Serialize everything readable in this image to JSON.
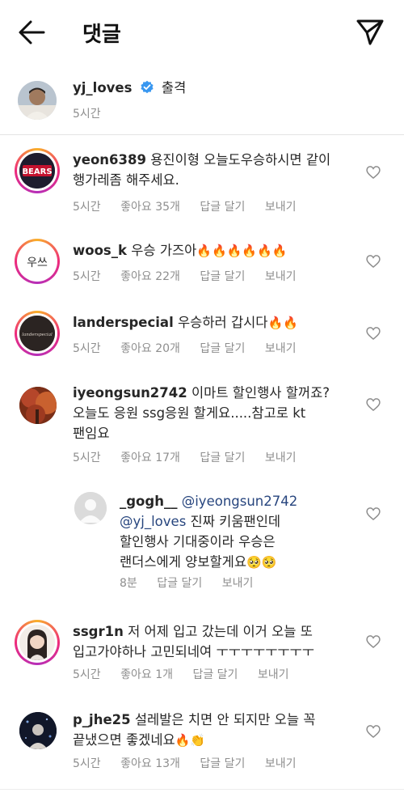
{
  "header": {
    "title": "댓글"
  },
  "caption": {
    "username": "yj_loves",
    "text": "출격",
    "time": "5시간"
  },
  "comments": [
    {
      "username": "yeon6389",
      "line1": "용진이형 오늘도우승하시면 같이",
      "line2": "행가레좀 해주세요.",
      "time": "5시간",
      "likes": "좋아요 35개",
      "reply": "답글 달기",
      "send": "보내기"
    },
    {
      "username": "woos_k",
      "line1": "우승 가즈아",
      "emoji": "🔥🔥🔥🔥🔥🔥",
      "time": "5시간",
      "likes": "좋아요 22개",
      "reply": "답글 달기",
      "send": "보내기"
    },
    {
      "username": "landerspecial",
      "line1": "우승하러 갑시다",
      "emoji": "🔥🔥",
      "time": "5시간",
      "likes": "좋아요 20개",
      "reply": "답글 달기",
      "send": "보내기"
    },
    {
      "username": "iyeongsun2742",
      "line1": "이마트 할인행사 할꺼죠?",
      "line2": "오늘도 응원 ssg응원 할게요.....참고로 kt",
      "line3": "팬임요",
      "time": "5시간",
      "likes": "좋아요 17개",
      "reply": "답글 달기",
      "send": "보내기"
    },
    {
      "username": "_gogh__",
      "mention1": "@iyeongsun2742",
      "mention2": "@yj_loves",
      "line2": "진짜 키움팬인데",
      "line3": "할인행사 기대중이라 우승은",
      "line4": "랜더스에게 양보할게요",
      "emoji": "🥺🥺",
      "time": "8분",
      "reply": "답글 달기",
      "send": "보내기"
    },
    {
      "username": "ssgr1n",
      "line1": "저 어제 입고 갔는데 이거 오늘 또",
      "line2": "입고가야하나 고민되네여 ㅜㅜㅜㅜㅜㅜㅜㅜ",
      "time": "5시간",
      "likes": "좋아요 1개",
      "reply": "답글 달기",
      "send": "보내기"
    },
    {
      "username": "p_jhe25",
      "line1": "설레발은 치면 안 되지만 오늘 꼭",
      "line2": "끝냈으면 좋겠네요",
      "emoji": "🔥👏",
      "time": "5시간",
      "likes": "좋아요 13개",
      "reply": "답글 달기",
      "send": "보내기"
    }
  ],
  "avatars": {
    "yeon6389": "BEARS",
    "woos_k": "우쓰",
    "landerspecial": "landerspecial"
  },
  "icons": [
    "back-arrow-icon",
    "send-icon",
    "verified-badge-icon",
    "heart-icon"
  ],
  "colors": {
    "verified": "#3897f0",
    "meta": "#8e8e8e",
    "mention": "#27457e",
    "ring": "#ee2a7b"
  }
}
